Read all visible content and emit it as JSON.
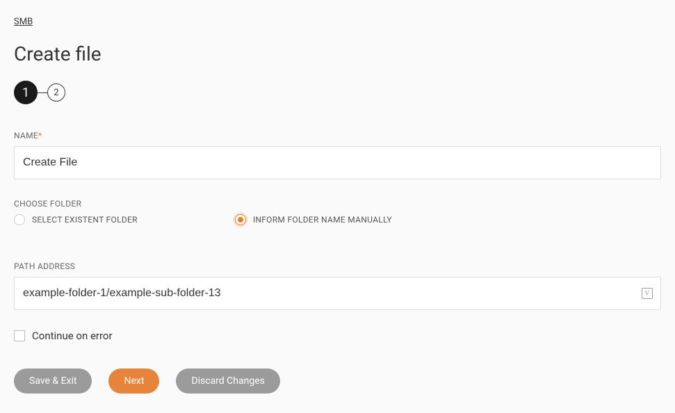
{
  "breadcrumb": "SMB",
  "page_title": "Create file",
  "stepper": {
    "step1": "1",
    "step2": "2"
  },
  "name_field": {
    "label": "NAME",
    "value": "Create File"
  },
  "choose_folder": {
    "label": "CHOOSE FOLDER",
    "option_existent": "SELECT EXISTENT FOLDER",
    "option_manual": "INFORM FOLDER NAME MANUALLY"
  },
  "path_address": {
    "label": "PATH ADDRESS",
    "value": "example-folder-1/example-sub-folder-13"
  },
  "continue_on_error": {
    "label": "Continue on error"
  },
  "buttons": {
    "save_exit": "Save & Exit",
    "next": "Next",
    "discard": "Discard Changes"
  }
}
